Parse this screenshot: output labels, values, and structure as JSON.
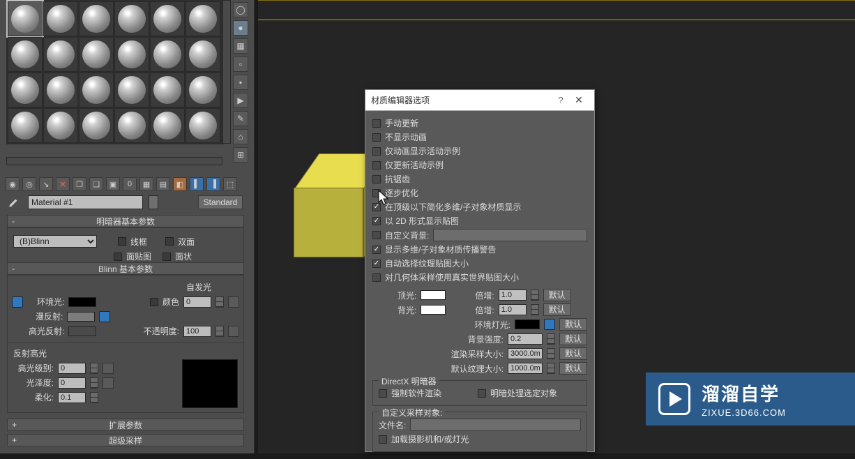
{
  "mat_panel": {
    "selected_slot_index": 0,
    "material_name": "Material #1",
    "material_type": "Standard",
    "toolbar": {
      "row_icons": [
        "eyedrop",
        "sphere",
        "sphere2",
        "delete",
        "boxes",
        "boxes2",
        "fx",
        "fx2",
        "fx3",
        "check",
        "cube",
        "cube2",
        "slot"
      ]
    },
    "rollout_shader": {
      "title": "明暗器基本参数",
      "shader_dropdown": "(B)Blinn",
      "wireframe": "线框",
      "twosided": "双面",
      "facemap": "面贴图",
      "faceted": "面状"
    },
    "rollout_blinn": {
      "title": "Blinn 基本参数",
      "selfillum_title": "自发光",
      "color_label": "颜色",
      "color_value": "0",
      "ambient_label": "环境光:",
      "diffuse_label": "漫反射:",
      "specular_label": "高光反射:",
      "opacity_label": "不透明度:",
      "opacity_value": "100"
    },
    "rollout_specular": {
      "title": "反射高光",
      "specular_level_label": "高光级别:",
      "specular_level_value": "0",
      "gloss_label": "光泽度:",
      "gloss_value": "0",
      "soften_label": "柔化:",
      "soften_value": "0.1"
    },
    "rollout_ext": {
      "title": "扩展参数"
    },
    "rollout_super": {
      "title": "超级采样"
    }
  },
  "dialog": {
    "title": "材质编辑器选项",
    "checks": {
      "manual_update": "手动更新",
      "dont_animate": "不显示动画",
      "anim_active": "仅动画显示活动示例",
      "update_active": "仅更新活动示例",
      "antialias": "抗锯齿",
      "progressive": "逐步优化",
      "simplify_below_root": "在顶级以下简化多维/子对象材质显示",
      "display2d": "以 2D 形式显示贴图",
      "custom_bg": "自定义背景:",
      "multi_warn": "显示多维/子对象材质传播警告",
      "auto_texsize": "自动选择纹理贴图大小",
      "realworld": "对几何体采样使用真实世界贴图大小"
    },
    "fields": {
      "toplight_label": "顶光:",
      "multiply_label": "倍增:",
      "multiply_value1": "1.0",
      "backlight_label": "背光:",
      "multiply_value2": "1.0",
      "env_light_label": "环境灯光:",
      "bg_intensity_label": "背景强度:",
      "bg_intensity_value": "0.2",
      "render_sample_label": "渲染采样大小:",
      "render_sample_value": "3000.0m",
      "default_tex_label": "默认纹理大小:",
      "default_tex_value": "1000.0m",
      "default_btn": "默认"
    },
    "directx": {
      "title": "DirectX 明暗器",
      "force_soft": "强制软件渲染",
      "shade_sel": "明暗处理选定对象"
    },
    "custom_sample": {
      "title": "自定义采样对象:",
      "filename_label": "文件名:",
      "load_cam": "加载摄影机和/或灯光"
    }
  },
  "watermark": {
    "cn": "溜溜自学",
    "url": "ZIXUE.3D66.COM"
  }
}
